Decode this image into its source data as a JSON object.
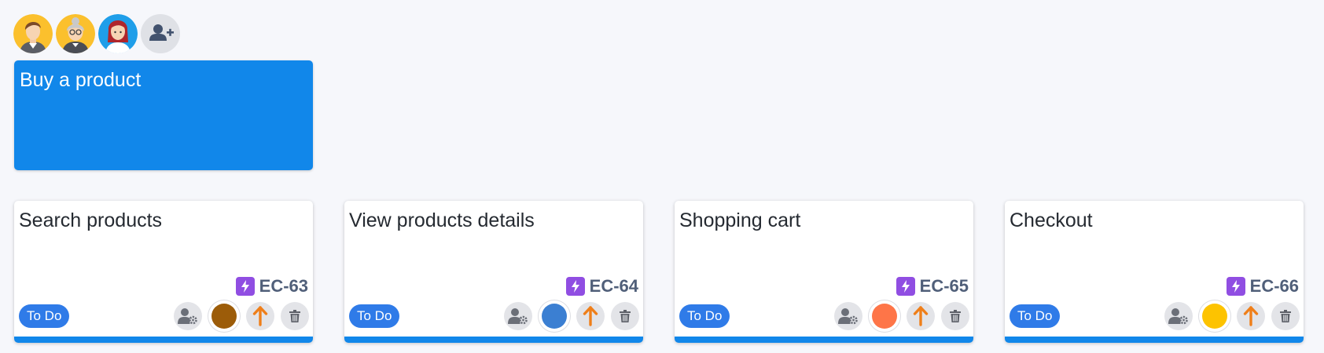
{
  "participants": [
    {
      "name": "man-avatar-icon"
    },
    {
      "name": "grandmother-avatar-icon"
    },
    {
      "name": "woman-avatar-icon"
    }
  ],
  "add_participant_icon": "add-user-icon",
  "epic": {
    "title": "Buy a product",
    "color": "#1187ea"
  },
  "cards": [
    {
      "title": "Search products",
      "key": "EC-63",
      "status": "To Do",
      "color": "#9c5c09"
    },
    {
      "title": "View products details",
      "key": "EC-64",
      "status": "To Do",
      "color": "#3b7fd2"
    },
    {
      "title": "Shopping cart",
      "key": "EC-65",
      "status": "To Do",
      "color": "#fe7548"
    },
    {
      "title": "Checkout",
      "key": "EC-66",
      "status": "To Do",
      "color": "#fdc300"
    }
  ],
  "colors": {
    "status_badge": "#2f7be8",
    "issue_type": "#904ee2",
    "priority_arrow": "#ef7f1a"
  }
}
